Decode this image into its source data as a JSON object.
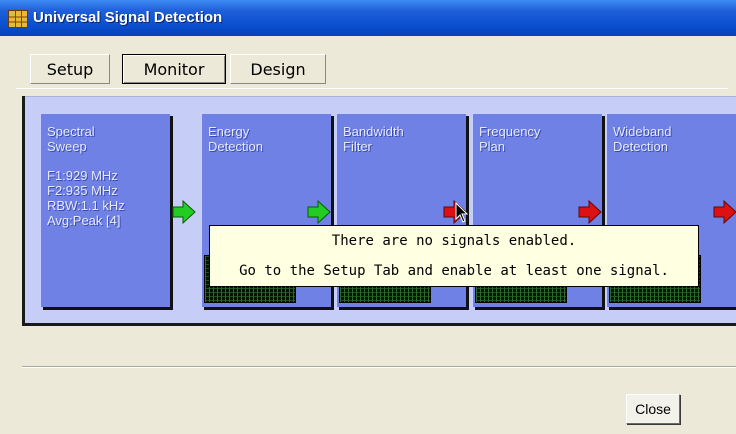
{
  "window": {
    "title": "Universal Signal Detection"
  },
  "tabs": [
    {
      "label": "Setup"
    },
    {
      "label": "Monitor"
    },
    {
      "label": "Design"
    }
  ],
  "blocks": [
    {
      "title": "Spectral\nSweep",
      "params": "F1:929 MHz\nF2:935 MHz\nRBW:1.1 kHz\nAvg:Peak [4]"
    },
    {
      "title": "Energy\nDetection",
      "params": ""
    },
    {
      "title": "Bandwidth\nFilter",
      "params": ""
    },
    {
      "title": "Frequency\nPlan",
      "params": ""
    },
    {
      "title": "Wideband\nDetection",
      "params": ""
    }
  ],
  "arrows": [
    {
      "color": "#22cc22",
      "icon": "arrow-right-icon"
    },
    {
      "color": "#22cc22",
      "icon": "arrow-right-icon"
    },
    {
      "color": "#dd1111",
      "icon": "arrow-right-icon"
    },
    {
      "color": "#dd1111",
      "icon": "arrow-right-icon"
    },
    {
      "color": "#dd1111",
      "icon": "arrow-right-icon"
    }
  ],
  "tooltip": {
    "line1": "There are no signals enabled.",
    "line2": "Go to the Setup Tab and enable at least one signal."
  },
  "buttons": {
    "close": "Close"
  },
  "colors": {
    "block": "#6f81e4",
    "panel": "#c6cdf7",
    "titlebar": "#0a4fd0",
    "tooltip": "#ffffe1"
  }
}
